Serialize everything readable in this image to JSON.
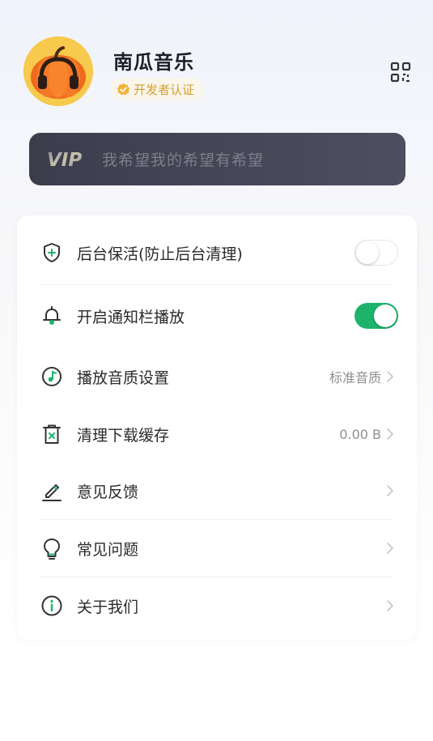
{
  "profile": {
    "app_name": "南瓜音乐",
    "badge_label": "开发者认证"
  },
  "vip": {
    "logo_text": "VIP",
    "slogan": "我希望我的希望有希望"
  },
  "settings": [
    {
      "label": "后台保活(防止后台清理)",
      "icon": "shield-plus-icon",
      "toggle": false
    },
    {
      "label": "开启通知栏播放",
      "icon": "bell-icon",
      "toggle": true
    },
    {
      "label": "播放音质设置",
      "icon": "music-note-icon",
      "value": "标准音质"
    },
    {
      "label": "清理下载缓存",
      "icon": "trash-icon",
      "value": "0.00 B"
    },
    {
      "label": "意见反馈",
      "icon": "edit-pen-icon"
    },
    {
      "label": "常见问题",
      "icon": "lightbulb-icon"
    },
    {
      "label": "关于我们",
      "icon": "info-icon"
    }
  ],
  "colors": {
    "accent_green": "#1db36b",
    "badge_gold": "#d3a131",
    "vip_bg": "#454655"
  }
}
